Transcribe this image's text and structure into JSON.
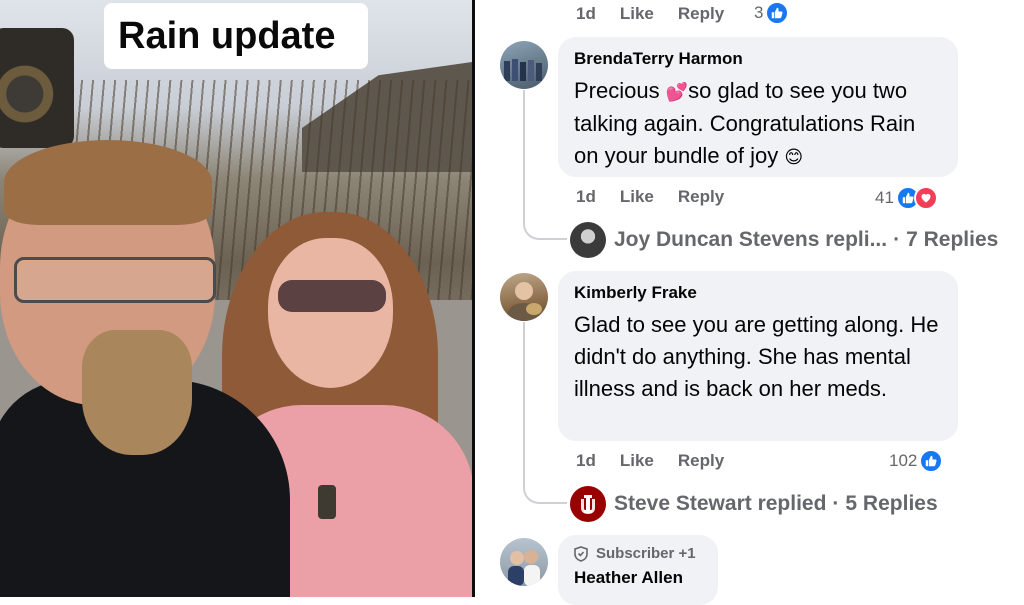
{
  "photo": {
    "caption": "Rain update"
  },
  "top_row": {
    "time": "1d",
    "like": "Like",
    "reply": "Reply",
    "count": "3"
  },
  "comments": [
    {
      "author": "BrendaTerry Harmon",
      "text_part1": "Precious",
      "emoji1": "💕",
      "text_part2": "so glad to see you two talking again. Congratulations Rain on your bundle of joy",
      "emoji2": "😊",
      "time": "1d",
      "like": "Like",
      "reply": "Reply",
      "reaction_count": "41",
      "replies": {
        "name_text": "Joy Duncan Stevens repli...",
        "sep": "·",
        "count_text": "7 Replies"
      }
    },
    {
      "author": "Kimberly Frake",
      "text": "Glad to see you are getting along. He didn't do anything. She has mental illness and is back on her meds.",
      "time": "1d",
      "like": "Like",
      "reply": "Reply",
      "reaction_count": "102",
      "replies": {
        "name_text": "Steve Stewart replied",
        "sep": "·",
        "count_text": "5 Replies"
      }
    },
    {
      "badge": "Subscriber +1",
      "author": "Heather Allen"
    }
  ],
  "icons": {
    "like": "thumbs-up",
    "love": "heart",
    "subscriber": "shield"
  },
  "colors": {
    "like_blue": "#1877f2",
    "love_red": "#f33e58",
    "bubble_bg": "#f0f2f5",
    "meta_gray": "#65676b"
  }
}
